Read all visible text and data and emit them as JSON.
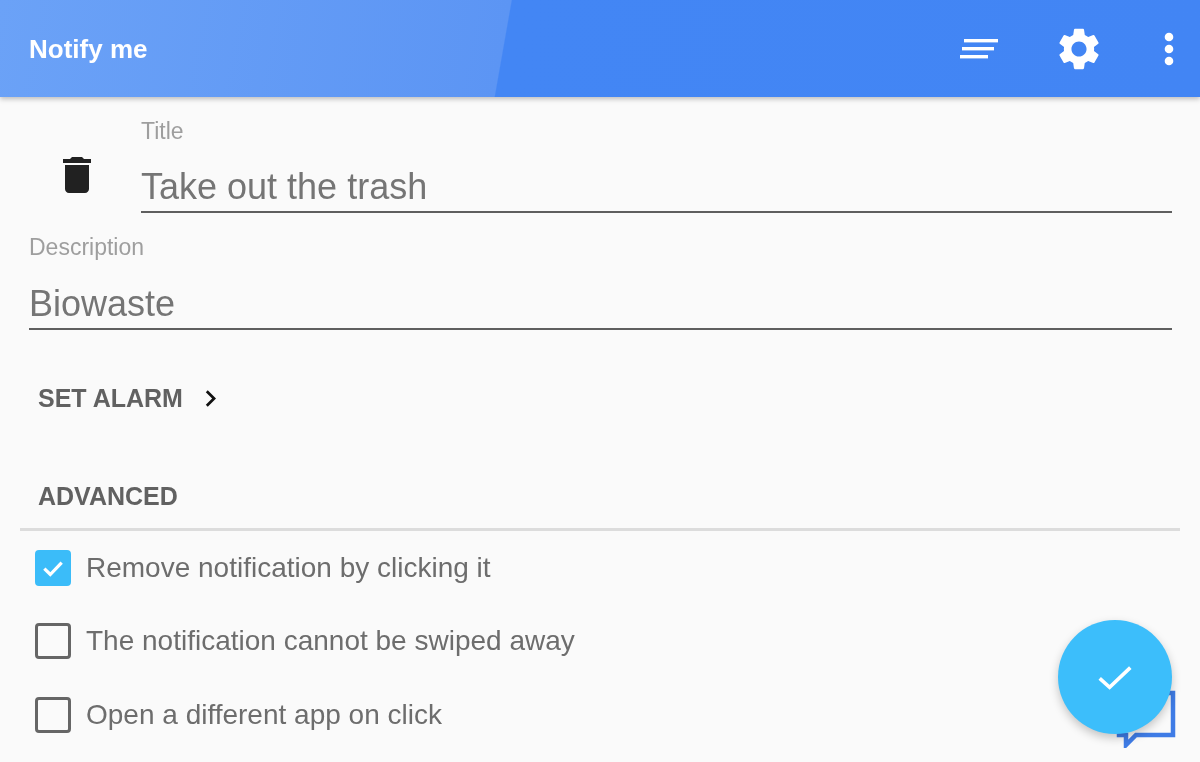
{
  "app_bar": {
    "title": "Notify me"
  },
  "title_field": {
    "label": "Title",
    "value": "Take out the trash"
  },
  "description_field": {
    "label": "Description",
    "value": "Biowaste"
  },
  "set_alarm_button": {
    "label": "SET ALARM"
  },
  "advanced": {
    "heading": "ADVANCED",
    "options": [
      {
        "label": "Remove notification by clicking it",
        "checked": true
      },
      {
        "label": "The notification cannot be swiped away",
        "checked": false
      },
      {
        "label": "Open a different app on click",
        "checked": false
      }
    ]
  }
}
